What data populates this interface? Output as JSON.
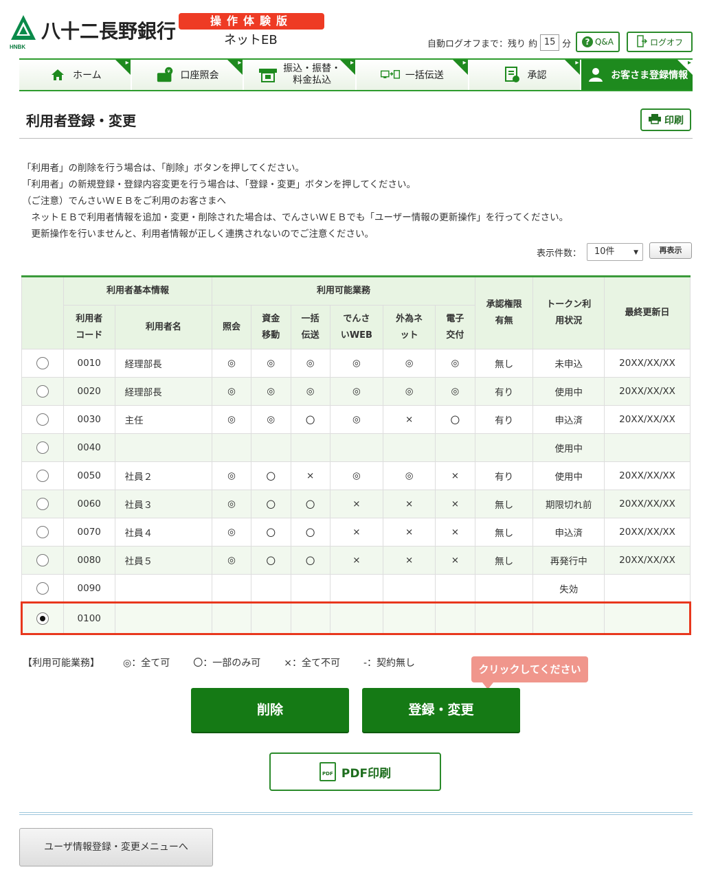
{
  "header": {
    "bank_name": "八十二長野銀行",
    "bank_abbr": "HNBK",
    "demo_badge": "操作体験版",
    "service_name": "ネットEB",
    "logoff_label": "自動ログオフまで：残り 約",
    "logoff_minutes": "15",
    "logoff_unit": "分",
    "qa_label": "Q&A",
    "logoff_button": "ログオフ"
  },
  "nav": {
    "items": [
      {
        "label": "ホーム",
        "icon": "home-icon"
      },
      {
        "label": "口座照会",
        "icon": "wallet-yen-icon"
      },
      {
        "label": "振込・振替・",
        "label2": "料金払込",
        "icon": "atm-icon"
      },
      {
        "label": "一括伝送",
        "icon": "transfer-icon"
      },
      {
        "label": "承認",
        "icon": "approval-icon"
      },
      {
        "label": "お客さま登録情報",
        "icon": "user-icon"
      }
    ],
    "active_index": 5
  },
  "page": {
    "title": "利用者登録・変更",
    "print_label": "印刷",
    "notes": [
      "「利用者」の削除を行う場合は、「削除」ボタンを押してください。",
      "「利用者」の新規登録・登録内容変更を行う場合は、「登録・変更」ボタンを押してください。",
      "（ご注意）でんさいＷＥＢをご利用のお客さまへ",
      "　ネットＥＢで利用者情報を追加・変更・削除された場合は、でんさいＷＥＢでも「ユーザー情報の更新操作」を行ってください。",
      "　更新操作を行いませんと、利用者情報が正しく連携されないのでご注意ください。"
    ],
    "per_page_label": "表示件数：",
    "per_page_value": "10件",
    "redisplay_label": "再表示"
  },
  "table": {
    "group_headers": {
      "basic": "利用者基本情報",
      "services": "利用可能業務"
    },
    "headers": {
      "code": "利用者コード",
      "code_l1": "利用者",
      "code_l2": "コード",
      "name": "利用者名",
      "inquiry": "照会",
      "funds_l1": "資金",
      "funds_l2": "移動",
      "bulk_l1": "一括",
      "bulk_l2": "伝送",
      "densai_l1": "でんさ",
      "densai_l2": "いWEB",
      "forex_l1": "外為ネ",
      "forex_l2": "ット",
      "edelivery_l1": "電子",
      "edelivery_l2": "交付",
      "approval_l1": "承認権限",
      "approval_l2": "有無",
      "token_l1": "トークン利",
      "token_l2": "用状況",
      "updated": "最終更新日"
    },
    "rows": [
      {
        "code": "0010",
        "name": "経理部長",
        "s": [
          "◎",
          "◎",
          "◎",
          "◎",
          "◎",
          "◎"
        ],
        "approval": "無し",
        "token": "未申込",
        "updated": "20XX/XX/XX"
      },
      {
        "code": "0020",
        "name": "経理部長",
        "s": [
          "◎",
          "◎",
          "◎",
          "◎",
          "◎",
          "◎"
        ],
        "approval": "有り",
        "token": "使用中",
        "updated": "20XX/XX/XX"
      },
      {
        "code": "0030",
        "name": "主任",
        "s": [
          "◎",
          "◎",
          "〇",
          "◎",
          "×",
          "〇"
        ],
        "approval": "有り",
        "token": "申込済",
        "updated": "20XX/XX/XX"
      },
      {
        "code": "0040",
        "name": "",
        "s": [
          "",
          "",
          "",
          "",
          "",
          ""
        ],
        "approval": "",
        "token": "使用中",
        "updated": ""
      },
      {
        "code": "0050",
        "name": "社員２",
        "s": [
          "◎",
          "〇",
          "×",
          "◎",
          "◎",
          "×"
        ],
        "approval": "有り",
        "token": "使用中",
        "updated": "20XX/XX/XX"
      },
      {
        "code": "0060",
        "name": "社員３",
        "s": [
          "◎",
          "〇",
          "〇",
          "×",
          "×",
          "×"
        ],
        "approval": "無し",
        "token": "期限切れ前",
        "updated": "20XX/XX/XX"
      },
      {
        "code": "0070",
        "name": "社員４",
        "s": [
          "◎",
          "〇",
          "〇",
          "×",
          "×",
          "×"
        ],
        "approval": "無し",
        "token": "申込済",
        "updated": "20XX/XX/XX"
      },
      {
        "code": "0080",
        "name": "社員５",
        "s": [
          "◎",
          "〇",
          "〇",
          "×",
          "×",
          "×"
        ],
        "approval": "無し",
        "token": "再発行中",
        "updated": "20XX/XX/XX"
      },
      {
        "code": "0090",
        "name": "",
        "s": [
          "",
          "",
          "",
          "",
          "",
          ""
        ],
        "approval": "",
        "token": "失効",
        "updated": ""
      },
      {
        "code": "0100",
        "name": "",
        "s": [
          "",
          "",
          "",
          "",
          "",
          ""
        ],
        "approval": "",
        "token": "",
        "updated": "",
        "selected": true
      }
    ]
  },
  "legend": {
    "title": "【利用可能業務】",
    "all": "◎：全て可",
    "partial": "〇：一部のみ可",
    "none": "×：全て不可",
    "no_contract": "-：契約無し"
  },
  "actions": {
    "tooltip": "クリックしてください",
    "delete": "削除",
    "register": "登録・変更",
    "pdf_print": "PDF印刷",
    "pdf_icon_text": "PDF",
    "back_menu": "ユーザ情報登録・変更メニューへ"
  },
  "colors": {
    "brand_green": "#157a15",
    "accent_red": "#ee3b24",
    "header_bg": "#e8f4e3"
  }
}
